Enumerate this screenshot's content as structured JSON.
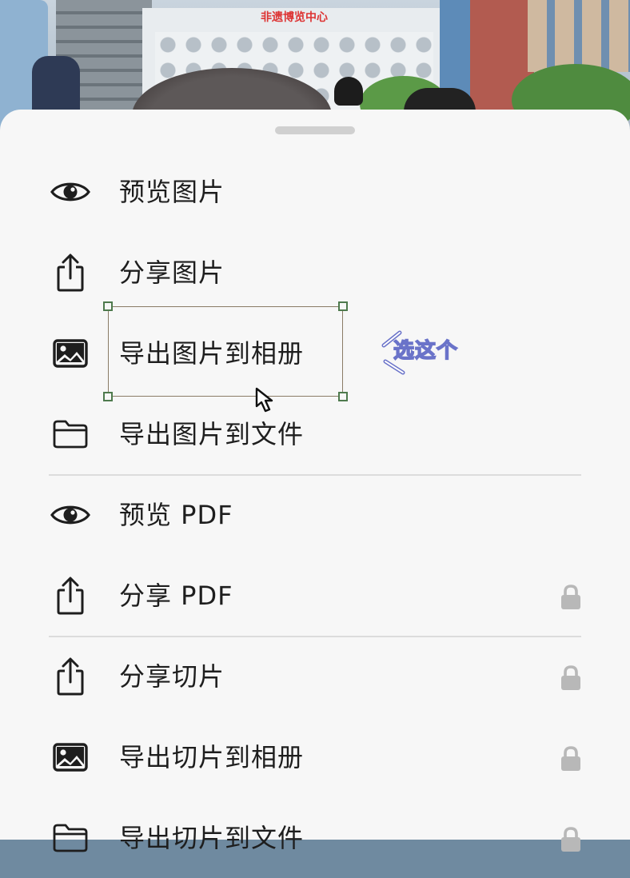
{
  "background": {
    "building_sign": "非遗博览中心"
  },
  "sheet": {
    "groups": [
      [
        {
          "label": "预览图片",
          "icon": "eye-icon",
          "locked": false
        },
        {
          "label": "分享图片",
          "icon": "share-icon",
          "locked": false
        },
        {
          "label": "导出图片到相册",
          "icon": "photo-icon",
          "locked": false
        },
        {
          "label": "导出图片到文件",
          "icon": "folder-icon",
          "locked": false
        }
      ],
      [
        {
          "label": "预览 PDF",
          "icon": "eye-icon",
          "locked": false
        },
        {
          "label": "分享 PDF",
          "icon": "share-icon",
          "locked": true
        }
      ],
      [
        {
          "label": "分享切片",
          "icon": "share-icon",
          "locked": true
        },
        {
          "label": "导出切片到相册",
          "icon": "photo-icon",
          "locked": true
        },
        {
          "label": "导出切片到文件",
          "icon": "folder-icon",
          "locked": true
        }
      ]
    ]
  },
  "annotation": {
    "callout": "选这个",
    "highlighted_item": "导出图片到相册"
  },
  "colors": {
    "sheet_bg": "#f7f7f7",
    "text": "#1e1e1e",
    "lock": "#b8b8b8",
    "handle": "#4e7a4d",
    "callout_stroke": "#6a73c9"
  }
}
